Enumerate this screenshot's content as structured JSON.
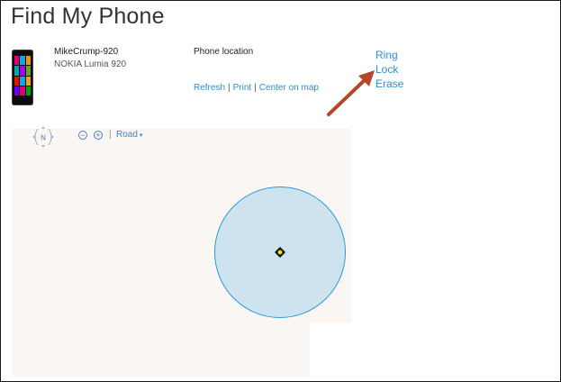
{
  "page": {
    "title": "Find My Phone"
  },
  "device": {
    "name": "MikeCrump-920",
    "model": "NOKIA Lumia 920",
    "tile_colors": [
      "#e3007a",
      "#1ba1e2",
      "#f09609",
      "#00aba9",
      "#a200ff",
      "#60a917",
      "#e51400",
      "#1ba1e2",
      "#f0a30a",
      "#6a00ff",
      "#d80073",
      "#00a300"
    ]
  },
  "location": {
    "label": "Phone location",
    "links": [
      "Refresh",
      "Print",
      "Center on map"
    ],
    "separator": "|"
  },
  "actions": [
    "Ring",
    "Lock",
    "Erase"
  ],
  "map": {
    "compass_label": "N",
    "zoom_out": "−",
    "zoom_in": "+",
    "separator": "|",
    "view_label": "Road",
    "view_caret": "▾"
  },
  "colors": {
    "link": "#2a8fd6",
    "arrow": "#b5452b",
    "radius_fill": "#cde4f0",
    "radius_stroke": "#2a9ad6",
    "pin": "#f5e400"
  }
}
